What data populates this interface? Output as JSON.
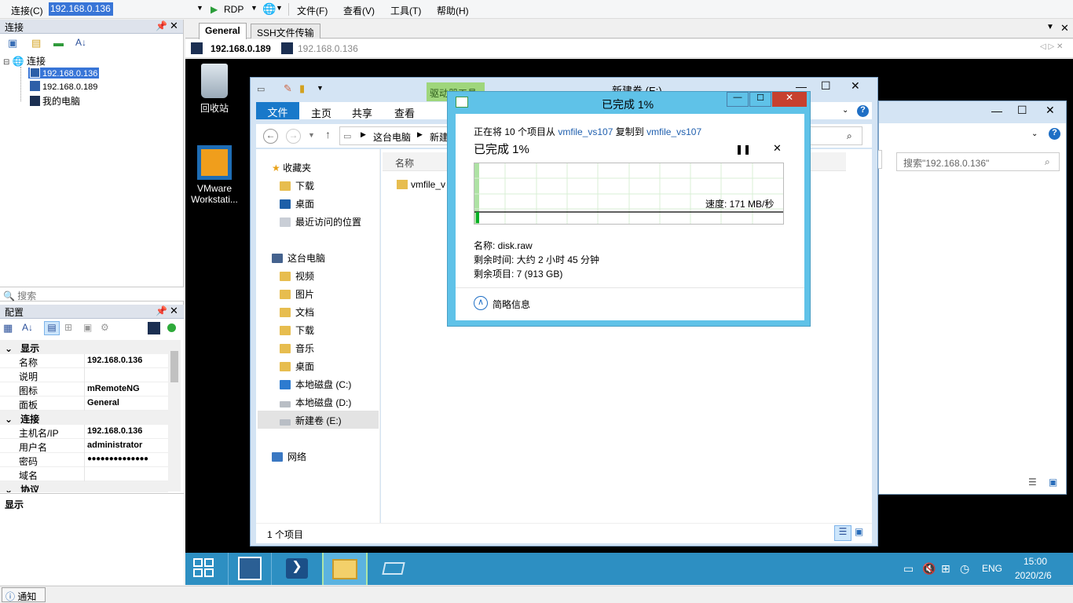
{
  "menubar": {
    "connect_label": "连接(C)",
    "host_value": "192.168.0.136",
    "rdp_label": "RDP",
    "file_menu": "文件(F)",
    "view_menu": "查看(V)",
    "tools_menu": "工具(T)",
    "help_menu": "帮助(H)"
  },
  "connections_pane": {
    "title": "连接",
    "root_label": "连接",
    "items": [
      "192.168.0.136",
      "192.168.0.189",
      "我的电脑"
    ],
    "search_placeholder": "搜索"
  },
  "config_pane": {
    "title": "配置",
    "cat_display": "显示",
    "cat_connection": "连接",
    "cat_protocol": "协议",
    "rows": [
      {
        "key": "名称",
        "value": "192.168.0.136"
      },
      {
        "key": "说明",
        "value": ""
      },
      {
        "key": "图标",
        "value": "mRemoteNG"
      },
      {
        "key": "面板",
        "value": "General"
      },
      {
        "key": "主机名/IP",
        "value": "192.168.0.136"
      },
      {
        "key": "用户名",
        "value": "administrator"
      },
      {
        "key": "密码",
        "value": "●●●●●●●●●●●●●●"
      },
      {
        "key": "域名",
        "value": ""
      }
    ],
    "desc_title": "显示"
  },
  "tabs": {
    "general": "General",
    "ssh": "SSH文件传输",
    "session1": "192.168.0.189",
    "session2": "192.168.0.136"
  },
  "desktop": {
    "recycle_label": "回收站",
    "vmware_label1": "VMware",
    "vmware_label2": "Workstati..."
  },
  "explorer": {
    "title": "新建卷 (E:)",
    "contextual_tab": "驱动器工具",
    "ribbon_tabs": [
      "文件",
      "主页",
      "共享",
      "查看"
    ],
    "breadcrumb": [
      "这台电脑",
      "新建"
    ],
    "column_name": "名称",
    "file_item": "vmfile_v",
    "status": "1 个项目",
    "nav": {
      "favorites": "收藏夹",
      "fav_items": [
        "下载",
        "桌面",
        "最近访问的位置"
      ],
      "this_pc": "这台电脑",
      "pc_items": [
        "视频",
        "图片",
        "文档",
        "下载",
        "音乐",
        "桌面",
        "本地磁盘 (C:)",
        "本地磁盘 (D:)",
        "新建卷 (E:)"
      ],
      "network": "网络"
    }
  },
  "explorer2": {
    "search_placeholder": "搜索\"192.168.0.136\""
  },
  "copy_dialog": {
    "title": "已完成 1%",
    "line_prefix": "正在将 10 个项目从",
    "source": "vmfile_vs107",
    "line_mid": "复制到",
    "dest": "vmfile_vs107",
    "progress_heading": "已完成 1%",
    "progress": 0.01,
    "speed": "速度: 171 MB/秒",
    "name_line": "名称: disk.raw",
    "time_line": "剩余时间: 大约 2 小时 45 分钟",
    "items_line": "剩余项目: 7 (913 GB)",
    "less_details": "简略信息"
  },
  "taskbar": {
    "lang": "ENG",
    "time": "15:00",
    "date": "2020/2/6"
  },
  "notify_label": "通知",
  "colors": {
    "accent": "#3875d7",
    "dialog_frame": "#5fc2e8",
    "close_red": "#c7402e",
    "taskbar": "#2d8fc2",
    "progress_green": "#06b025"
  }
}
